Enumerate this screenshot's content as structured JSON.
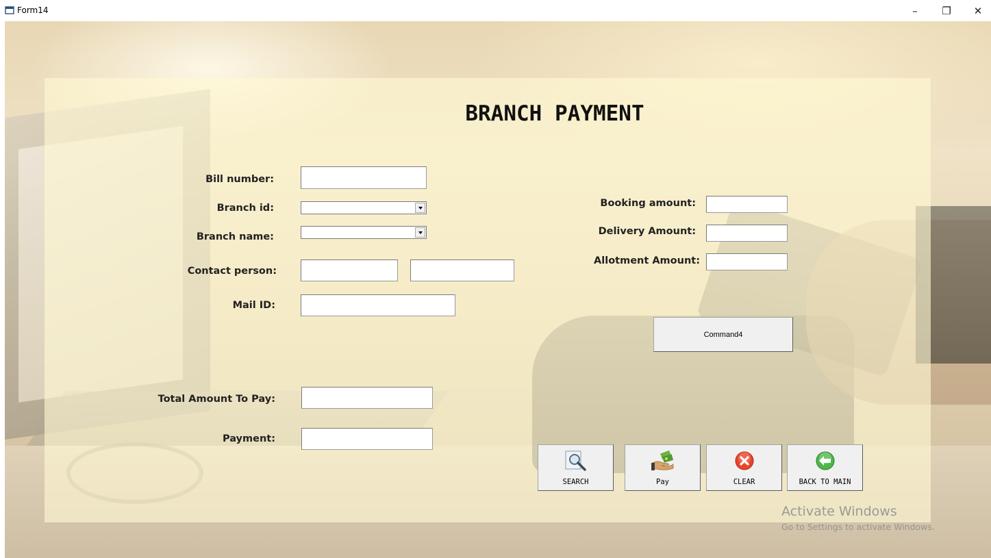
{
  "window": {
    "title": "Form14",
    "min_glyph": "–",
    "max_glyph": "❐",
    "close_glyph": "✕"
  },
  "form": {
    "heading": "BRANCH PAYMENT",
    "labels": {
      "bill_number": "Bill number:",
      "branch_id": "Branch id:",
      "branch_name": "Branch name:",
      "contact_person": "Contact person:",
      "mail_id": "Mail ID:",
      "total_amount": "Total Amount To Pay:",
      "payment": "Payment:",
      "booking_amount": "Booking amount:",
      "delivery_amount": "Delivery Amount:",
      "allotment_amount": "Allotment Amount:"
    },
    "values": {
      "bill_number": "",
      "branch_id": "",
      "branch_name": "",
      "contact_person_1": "",
      "contact_person_2": "",
      "mail_id": "",
      "total_amount": "",
      "payment": "",
      "booking_amount": "",
      "delivery_amount": "",
      "allotment_amount": ""
    }
  },
  "buttons": {
    "command4": "Command4",
    "search": "SEARCH",
    "pay": "Pay",
    "clear": "CLEAR",
    "back": "BACK TO MAIN"
  },
  "icons": {
    "search": "magnifier-icon",
    "pay": "money-hand-icon",
    "clear": "red-x-circle-icon",
    "back": "green-back-arrow-icon"
  },
  "colors": {
    "clear_icon": "#e8452c",
    "back_icon": "#4cb849",
    "panel": "#fff8d4"
  },
  "watermark": {
    "title": "Activate Windows",
    "subtitle": "Go to Settings to activate Windows."
  }
}
